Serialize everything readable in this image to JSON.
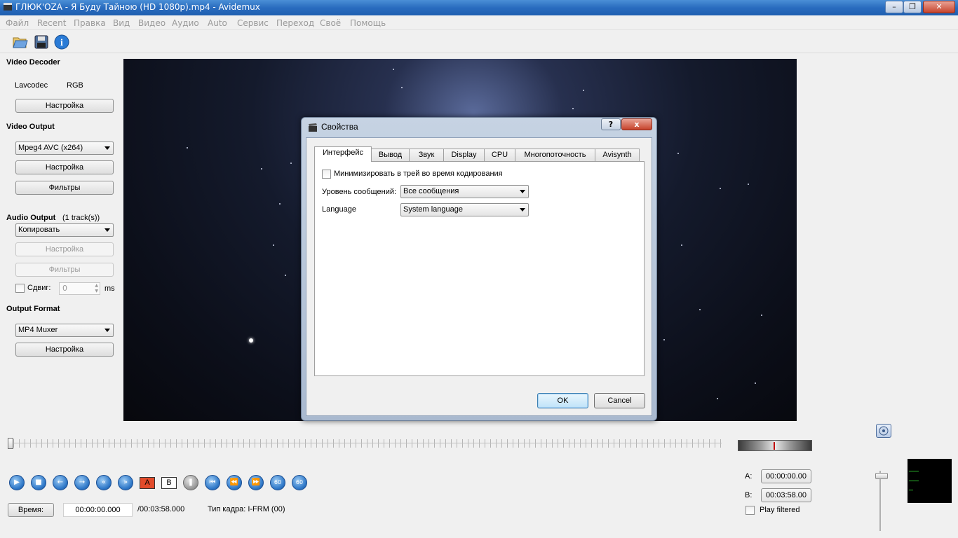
{
  "window": {
    "title": "ГЛЮК'OZA - Я Буду Тайною (HD 1080p).mp4 - Avidemux"
  },
  "menu": [
    "Файл",
    "Recent",
    "Правка",
    "Вид",
    "Видео",
    "Аудио",
    "Auto",
    "Сервис",
    "Переход",
    "Своё",
    "Помощь"
  ],
  "toolbar": {
    "icons": [
      "open-file-icon",
      "save-icon",
      "info-icon"
    ]
  },
  "left_panel": {
    "video_decoder": {
      "title": "Video Decoder",
      "codec": "Lavcodec",
      "format": "RGB",
      "config_label": "Настройка"
    },
    "video_output": {
      "title": "Video Output",
      "codec": "Mpeg4 AVC (x264)",
      "config_label": "Настройка",
      "filters_label": "Фильтры"
    },
    "audio_output": {
      "title": "Audio Output",
      "tracks": "(1 track(s))",
      "mode": "Копировать",
      "config_label": "Настройка",
      "filters_label": "Фильтры",
      "shift_label": "Сдвиг:",
      "shift_value": "0",
      "shift_unit": "ms"
    },
    "output_format": {
      "title": "Output Format",
      "muxer": "MP4 Muxer",
      "config_label": "Настройка"
    }
  },
  "dialog": {
    "title": "Свойства",
    "help_label": "?",
    "close_label": "x",
    "tabs": [
      "Интерфейс",
      "Вывод",
      "Звук",
      "Display",
      "CPU",
      "Многопоточность",
      "Avisynth"
    ],
    "active_tab": "Интерфейс",
    "minimize_label": "Минимизировать в трей во время кодирования",
    "message_level_label": "Уровень сообщений:",
    "message_level_value": "Все сообщения",
    "language_label": "Language",
    "language_value": "System language",
    "ok_label": "OK",
    "cancel_label": "Cancel"
  },
  "bottom": {
    "mark_a": "A",
    "mark_b": "B",
    "time_button": "Время:",
    "current_time": "00:00:00.000",
    "total_time": "/00:03:58.000",
    "frame_type": "Тип кадра:  I-FRM (00)",
    "a_label": "A:",
    "a_time": "00:00:00.00",
    "b_label": "B:",
    "b_time": "00:03:58.00",
    "play_filtered": "Play filtered",
    "speed_label_1": "60",
    "speed_label_2": "60"
  },
  "colors": {
    "title_bar": "#2a6cbf",
    "accent": "#2f78c8",
    "marker": "#c00000"
  }
}
